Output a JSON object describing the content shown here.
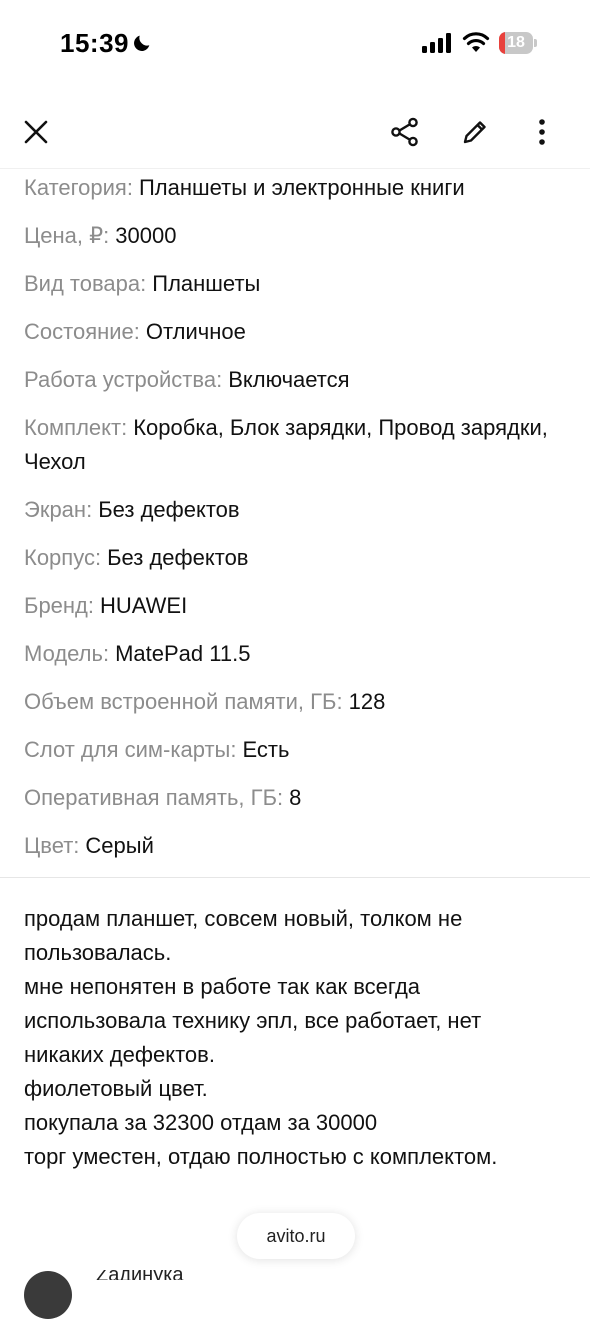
{
  "status_bar": {
    "time": "15:39",
    "battery": "18",
    "battery_level": 0.18,
    "icons": [
      "moon-icon",
      "signal-icon",
      "wifi-icon",
      "battery-icon"
    ]
  },
  "toolbar": {
    "icons": [
      "close-icon",
      "share-icon",
      "edit-icon",
      "more-icon"
    ]
  },
  "params": [
    {
      "label": "Категория",
      "value": "Планшеты и электронные книги"
    },
    {
      "label": "Цена, ₽",
      "value": "30000"
    },
    {
      "label": "Вид товара",
      "value": "Планшеты"
    },
    {
      "label": "Состояние",
      "value": "Отличное"
    },
    {
      "label": "Работа устройства",
      "value": "Включается"
    },
    {
      "label": "Комплект",
      "value": "Коробка, Блок зарядки, Провод зарядки, Чехол"
    },
    {
      "label": "Экран",
      "value": "Без дефектов"
    },
    {
      "label": "Корпус",
      "value": "Без дефектов"
    },
    {
      "label": "Бренд",
      "value": "HUAWEI"
    },
    {
      "label": "Модель",
      "value": "MatePad 11.5"
    },
    {
      "label": "Объем встроенной памяти, ГБ",
      "value": "128"
    },
    {
      "label": "Слот для сим-карты",
      "value": "Есть"
    },
    {
      "label": "Оперативная память, ГБ",
      "value": "8"
    },
    {
      "label": "Цвет",
      "value": "Серый"
    }
  ],
  "description": [
    "продам планшет, совсем новый, толком не пользовалась.",
    "мне непонятен в работе так как всегда использовала технику эпл, все работает, нет никаких дефектов.",
    "фиолетовый цвет.",
    "покупала за 32300 отдам за 30000",
    "торг уместен, отдаю полностью с комплектом."
  ],
  "url_pill": "avito.ru",
  "seller": {
    "name": "Zaдинука"
  },
  "colors": {
    "label_gray": "#8c8c8c",
    "text": "#111111",
    "battery_red": "#e8413c"
  }
}
